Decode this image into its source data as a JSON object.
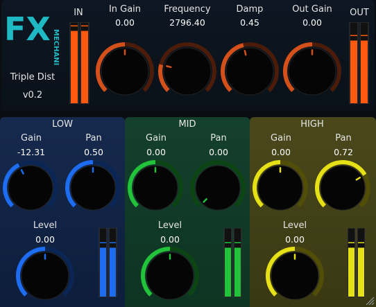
{
  "header": {
    "logo_letters": "FX",
    "logo_subtext": "MECHANIC",
    "plugin_name": "Triple Dist",
    "version": "v0.2",
    "in_label": "IN",
    "out_label": "OUT",
    "controls": [
      {
        "label": "In Gain",
        "value": "0.00",
        "level": 0.5,
        "color": "#d4501a"
      },
      {
        "label": "Frequency",
        "value": "2796.40",
        "level": 0.22,
        "color": "#d4501a"
      },
      {
        "label": "Damp",
        "value": "0.45",
        "level": 0.45,
        "color": "#d4501a"
      },
      {
        "label": "Out Gain",
        "value": "0.00",
        "level": 0.5,
        "color": "#d4501a"
      }
    ],
    "meter_in_level": 0.9,
    "meter_out_level": 0.78,
    "meter_color": "#ff5a10"
  },
  "bands": [
    {
      "name": "LOW",
      "color": "#1e6cf0",
      "gain": {
        "label": "Gain",
        "value": "-12.31",
        "level": 0.4
      },
      "pan": {
        "label": "Pan",
        "value": "0.50",
        "level": 0.5
      },
      "level": {
        "label": "Level",
        "value": "0.00",
        "level": 0.5
      },
      "meter_level": 0.72
    },
    {
      "name": "MID",
      "color": "#22c23a",
      "gain": {
        "label": "Gain",
        "value": "0.00",
        "level": 0.5
      },
      "pan": {
        "label": "Pan",
        "value": "0.00",
        "level": 0.0
      },
      "level": {
        "label": "Level",
        "value": "0.00",
        "level": 0.5
      },
      "meter_level": 0.72
    },
    {
      "name": "HIGH",
      "color": "#e6e016",
      "gain": {
        "label": "Gain",
        "value": "0.00",
        "level": 0.5
      },
      "pan": {
        "label": "Pan",
        "value": "0.72",
        "level": 0.72
      },
      "level": {
        "label": "Level",
        "value": "0.00",
        "level": 0.5
      },
      "meter_level": 0.72
    }
  ]
}
